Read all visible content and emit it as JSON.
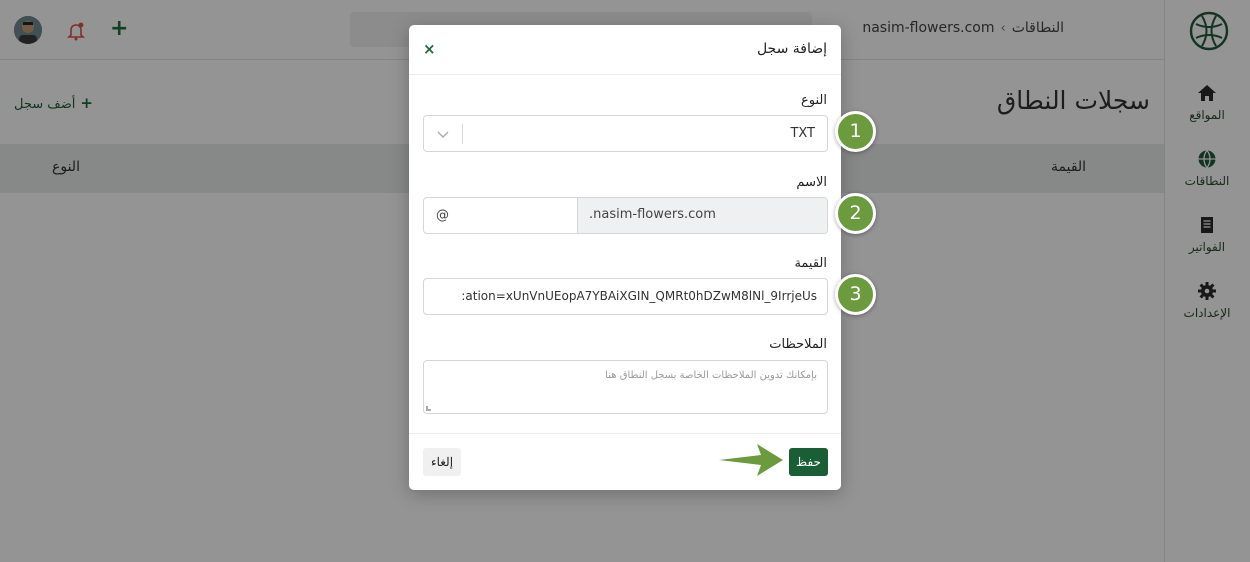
{
  "topbar": {
    "breadcrumb_root": "النطاقات",
    "breadcrumb_current": "nasim-flowers.com"
  },
  "sidebar": {
    "items": [
      {
        "label": "المواقع",
        "icon": "home-icon"
      },
      {
        "label": "النطاقات",
        "icon": "globe-icon"
      },
      {
        "label": "الفواتير",
        "icon": "invoice-icon"
      },
      {
        "label": "الإعدادات",
        "icon": "gear-icon"
      }
    ]
  },
  "page": {
    "title": "سجلات النطاق",
    "add_record": "أضف سجل",
    "columns": [
      "النوع",
      "القيمة"
    ]
  },
  "modal": {
    "title": "إضافة سجل",
    "close": "×",
    "type_label": "النوع",
    "type_value": "TXT",
    "name_label": "الاسم",
    "name_value": "@",
    "name_suffix": ".nasim-flowers.com",
    "value_label": "القيمة",
    "value_text": ":ation=xUnVnUEopA7YBAiXGIN_QMRt0hDZwM8lNl_9IrrjeUs",
    "notes_label": "الملاحظات",
    "notes_placeholder": "بإمكانك تدوين الملاحظات الخاصة بسجل النطاق هنا",
    "save": "حفظ",
    "cancel": "إلغاء"
  },
  "callouts": [
    "1",
    "2",
    "3"
  ],
  "colors": {
    "brand_green": "#1a5e35",
    "callout_green": "#6c9b3e",
    "overlay": "rgba(0,0,0,0.42)"
  }
}
